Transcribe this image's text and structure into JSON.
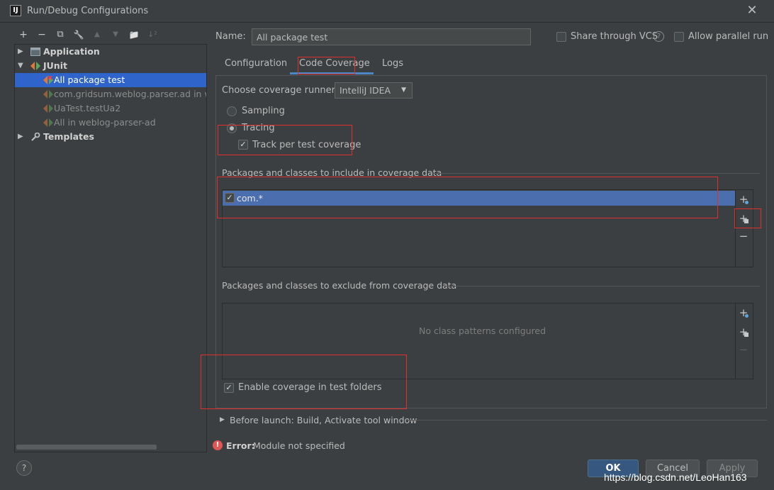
{
  "window": {
    "title": "Run/Debug Configurations",
    "app_icon_text": "IJ",
    "close_glyph": "✕"
  },
  "toolbar": {
    "add": "+",
    "remove": "−",
    "copy": "⧉",
    "edit_defaults": "🔧",
    "move_up": "▲",
    "move_down": "▼",
    "folder": "📁",
    "sort": "↓²"
  },
  "tree": {
    "items": [
      {
        "label": "Application",
        "style": "bold",
        "expander": "▶"
      },
      {
        "label": "JUnit",
        "style": "bold",
        "expander": "▼"
      },
      {
        "label": "All package test",
        "style": "selected"
      },
      {
        "label": "com.gridsum.weblog.parser.ad in we",
        "style": "grey"
      },
      {
        "label": "UaTest.testUa2",
        "style": "grey"
      },
      {
        "label": "All in weblog-parser-ad",
        "style": "grey"
      },
      {
        "label": "Templates",
        "style": "bold",
        "expander": "▶"
      }
    ]
  },
  "form": {
    "name_label": "Name:",
    "name_value": "All package test",
    "share_vcs_label": "Share through VCS",
    "share_vcs_checked": false,
    "help_glyph": "?",
    "allow_parallel_label": "Allow parallel run",
    "allow_parallel_checked": false
  },
  "tabs": [
    {
      "label": "Configuration",
      "active": false
    },
    {
      "label": "Code Coverage",
      "active": true
    },
    {
      "label": "Logs",
      "active": false
    }
  ],
  "coverage": {
    "runner_label": "Choose coverage runner:",
    "runner_value": "IntelliJ IDEA",
    "sampling_label": "Sampling",
    "tracing_label": "Tracing",
    "selected_mode": "Tracing",
    "track_per_test_label": "Track per test coverage",
    "track_per_test_checked": true,
    "include_title": "Packages and classes to include in coverage data",
    "include_items": [
      {
        "label": "com.*",
        "checked": true
      }
    ],
    "exclude_title": "Packages and classes to exclude from coverage data",
    "exclude_empty_text": "No class patterns configured",
    "enable_test_folders_label": "Enable coverage in test folders",
    "enable_test_folders_checked": true
  },
  "before_launch": {
    "label": "Before launch: Build, Activate tool window",
    "expander": "▶"
  },
  "error": {
    "icon": "!",
    "title": "Error:",
    "message": "Module not specified"
  },
  "buttons": {
    "help": "?",
    "ok": "OK",
    "cancel": "Cancel",
    "apply": "Apply"
  },
  "watermark": "https://blog.csdn.net/LeoHan163",
  "colors": {
    "background": "#3c3f41",
    "selection": "#4b6eaf",
    "tree_selection": "#2f65ca",
    "annotation": "#e0302e",
    "error": "#e05555",
    "primary_button": "#365880"
  }
}
